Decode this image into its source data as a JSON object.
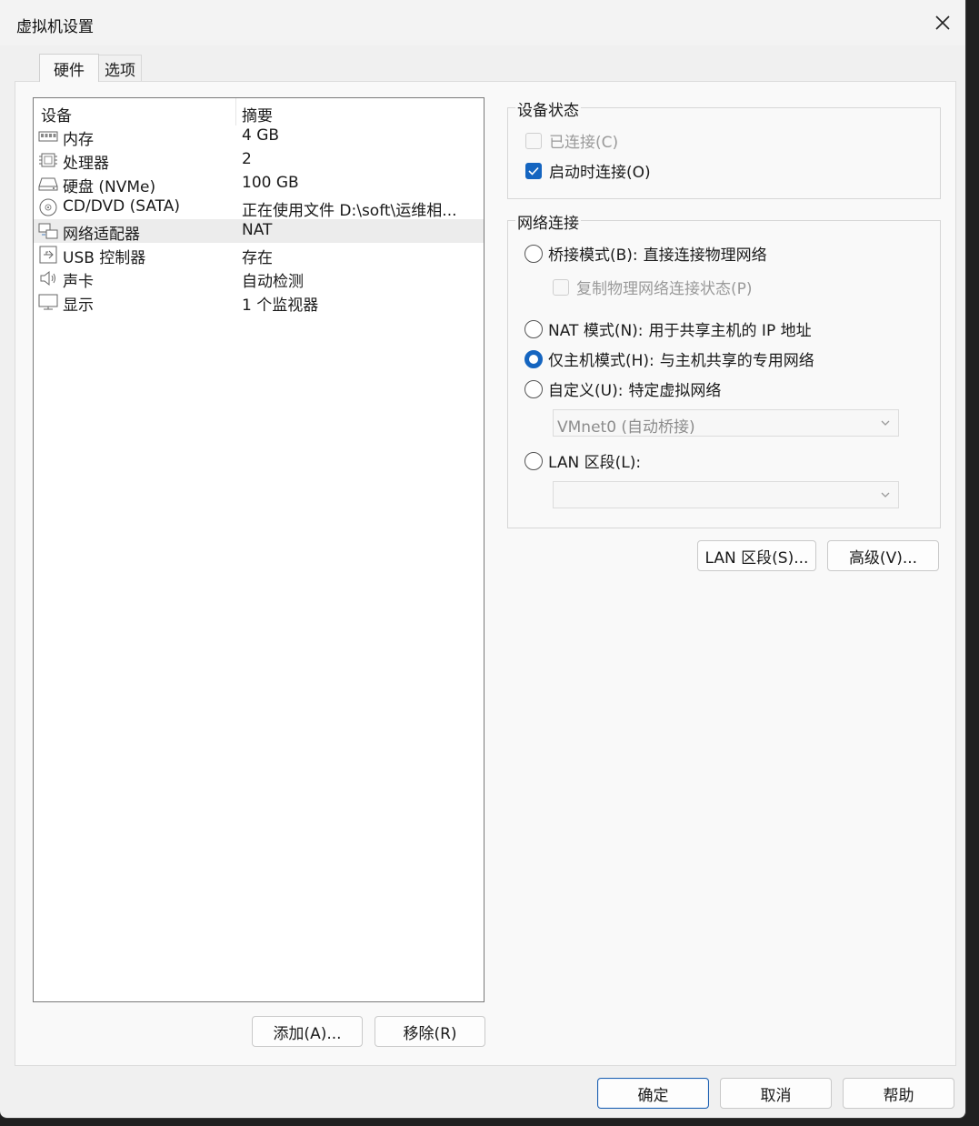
{
  "window": {
    "title": "虚拟机设置"
  },
  "tabs": [
    {
      "label": "硬件",
      "active": true
    },
    {
      "label": "选项",
      "active": false
    }
  ],
  "device_list": {
    "headers": {
      "device": "设备",
      "summary": "摘要"
    },
    "rows": [
      {
        "icon": "memory-icon",
        "name": "内存",
        "summary": "4 GB",
        "selected": false
      },
      {
        "icon": "processor-icon",
        "name": "处理器",
        "summary": "2",
        "selected": false
      },
      {
        "icon": "harddisk-icon",
        "name": "硬盘 (NVMe)",
        "summary": "100 GB",
        "selected": false
      },
      {
        "icon": "cd-dvd-icon",
        "name": "CD/DVD (SATA)",
        "summary": "正在使用文件 D:\\soft\\运维相...",
        "selected": false
      },
      {
        "icon": "network-adapter-icon",
        "name": "网络适配器",
        "summary": "NAT",
        "selected": true
      },
      {
        "icon": "usb-icon",
        "name": "USB 控制器",
        "summary": "存在",
        "selected": false
      },
      {
        "icon": "sound-icon",
        "name": "声卡",
        "summary": "自动检测",
        "selected": false
      },
      {
        "icon": "display-icon",
        "name": "显示",
        "summary": "1 个监视器",
        "selected": false
      }
    ]
  },
  "list_buttons": {
    "add": "添加(A)...",
    "remove": "移除(R)"
  },
  "device_status": {
    "title": "设备状态",
    "connected": {
      "label": "已连接(C)",
      "checked": false,
      "disabled": true
    },
    "connect_on_power_on": {
      "label": "启动时连接(O)",
      "checked": true,
      "disabled": false
    }
  },
  "network_connection": {
    "title": "网络连接",
    "bridged": {
      "label": "桥接模式(B):",
      "desc": "直接连接物理网络",
      "selected": false
    },
    "replicate_state": {
      "label": "复制物理网络连接状态(P)",
      "checked": false,
      "disabled": true
    },
    "nat": {
      "label": "NAT 模式(N):",
      "desc": "用于共享主机的 IP 地址",
      "selected": false
    },
    "host_only": {
      "label": "仅主机模式(H):",
      "desc": "与主机共享的专用网络",
      "selected": true
    },
    "custom": {
      "label": "自定义(U):",
      "desc": "特定虚拟网络",
      "selected": false
    },
    "custom_select": {
      "value": "VMnet0",
      "note": "(自动桥接)"
    },
    "lan_segment": {
      "label": "LAN 区段(L):",
      "selected": false
    },
    "lan_select": {
      "value": ""
    }
  },
  "panel_buttons": {
    "lan_segments": "LAN 区段(S)...",
    "advanced": "高级(V)..."
  },
  "footer_buttons": {
    "ok": "确定",
    "cancel": "取消",
    "help": "帮助"
  },
  "accent_color": "#1565c0"
}
